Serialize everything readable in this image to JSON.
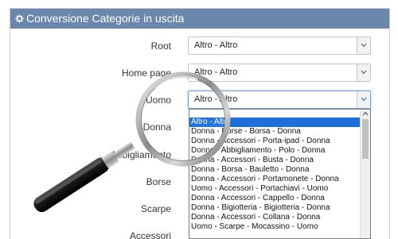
{
  "header": {
    "title": "Conversione Categorie in uscita",
    "icon": "gear-icon"
  },
  "rows": [
    {
      "label": "Root",
      "value": "Altro - Altro"
    },
    {
      "label": "Home page",
      "value": "Altro - Altro"
    },
    {
      "label": "Uomo",
      "value": "Altro - Altro"
    },
    {
      "label": "Donna"
    },
    {
      "label": "Abbigliamento"
    },
    {
      "label": "Borse"
    },
    {
      "label": "Scarpe"
    },
    {
      "label": "Accessori"
    }
  ],
  "dropdown": {
    "selected_index": 0,
    "options": [
      "Altro - Altro",
      "Donna - Borse - Borsa - Donna",
      "Donna - Accessori - Porta-ipad - Donna",
      "Donna - Abbigliamento - Polo - Donna",
      "Donna - Accessori - Busta - Donna",
      "Donna - Borsa - Bauletto - Donna",
      "Donna - Accessori - Portamonete - Donna",
      "Uomo - Accessori - Portachiavi - Uomo",
      "Donna - Accessori - Cappello - Donna",
      "Donna - Bigiotteria - Bigiotteria - Donna",
      "Donna - Accessori - Collana - Donna",
      "Uomo - Scarpe - Mocassino - Uomo"
    ]
  },
  "colors": {
    "header_bg": "#6b87ab",
    "selected_option_bg": "#1e6fd9"
  }
}
